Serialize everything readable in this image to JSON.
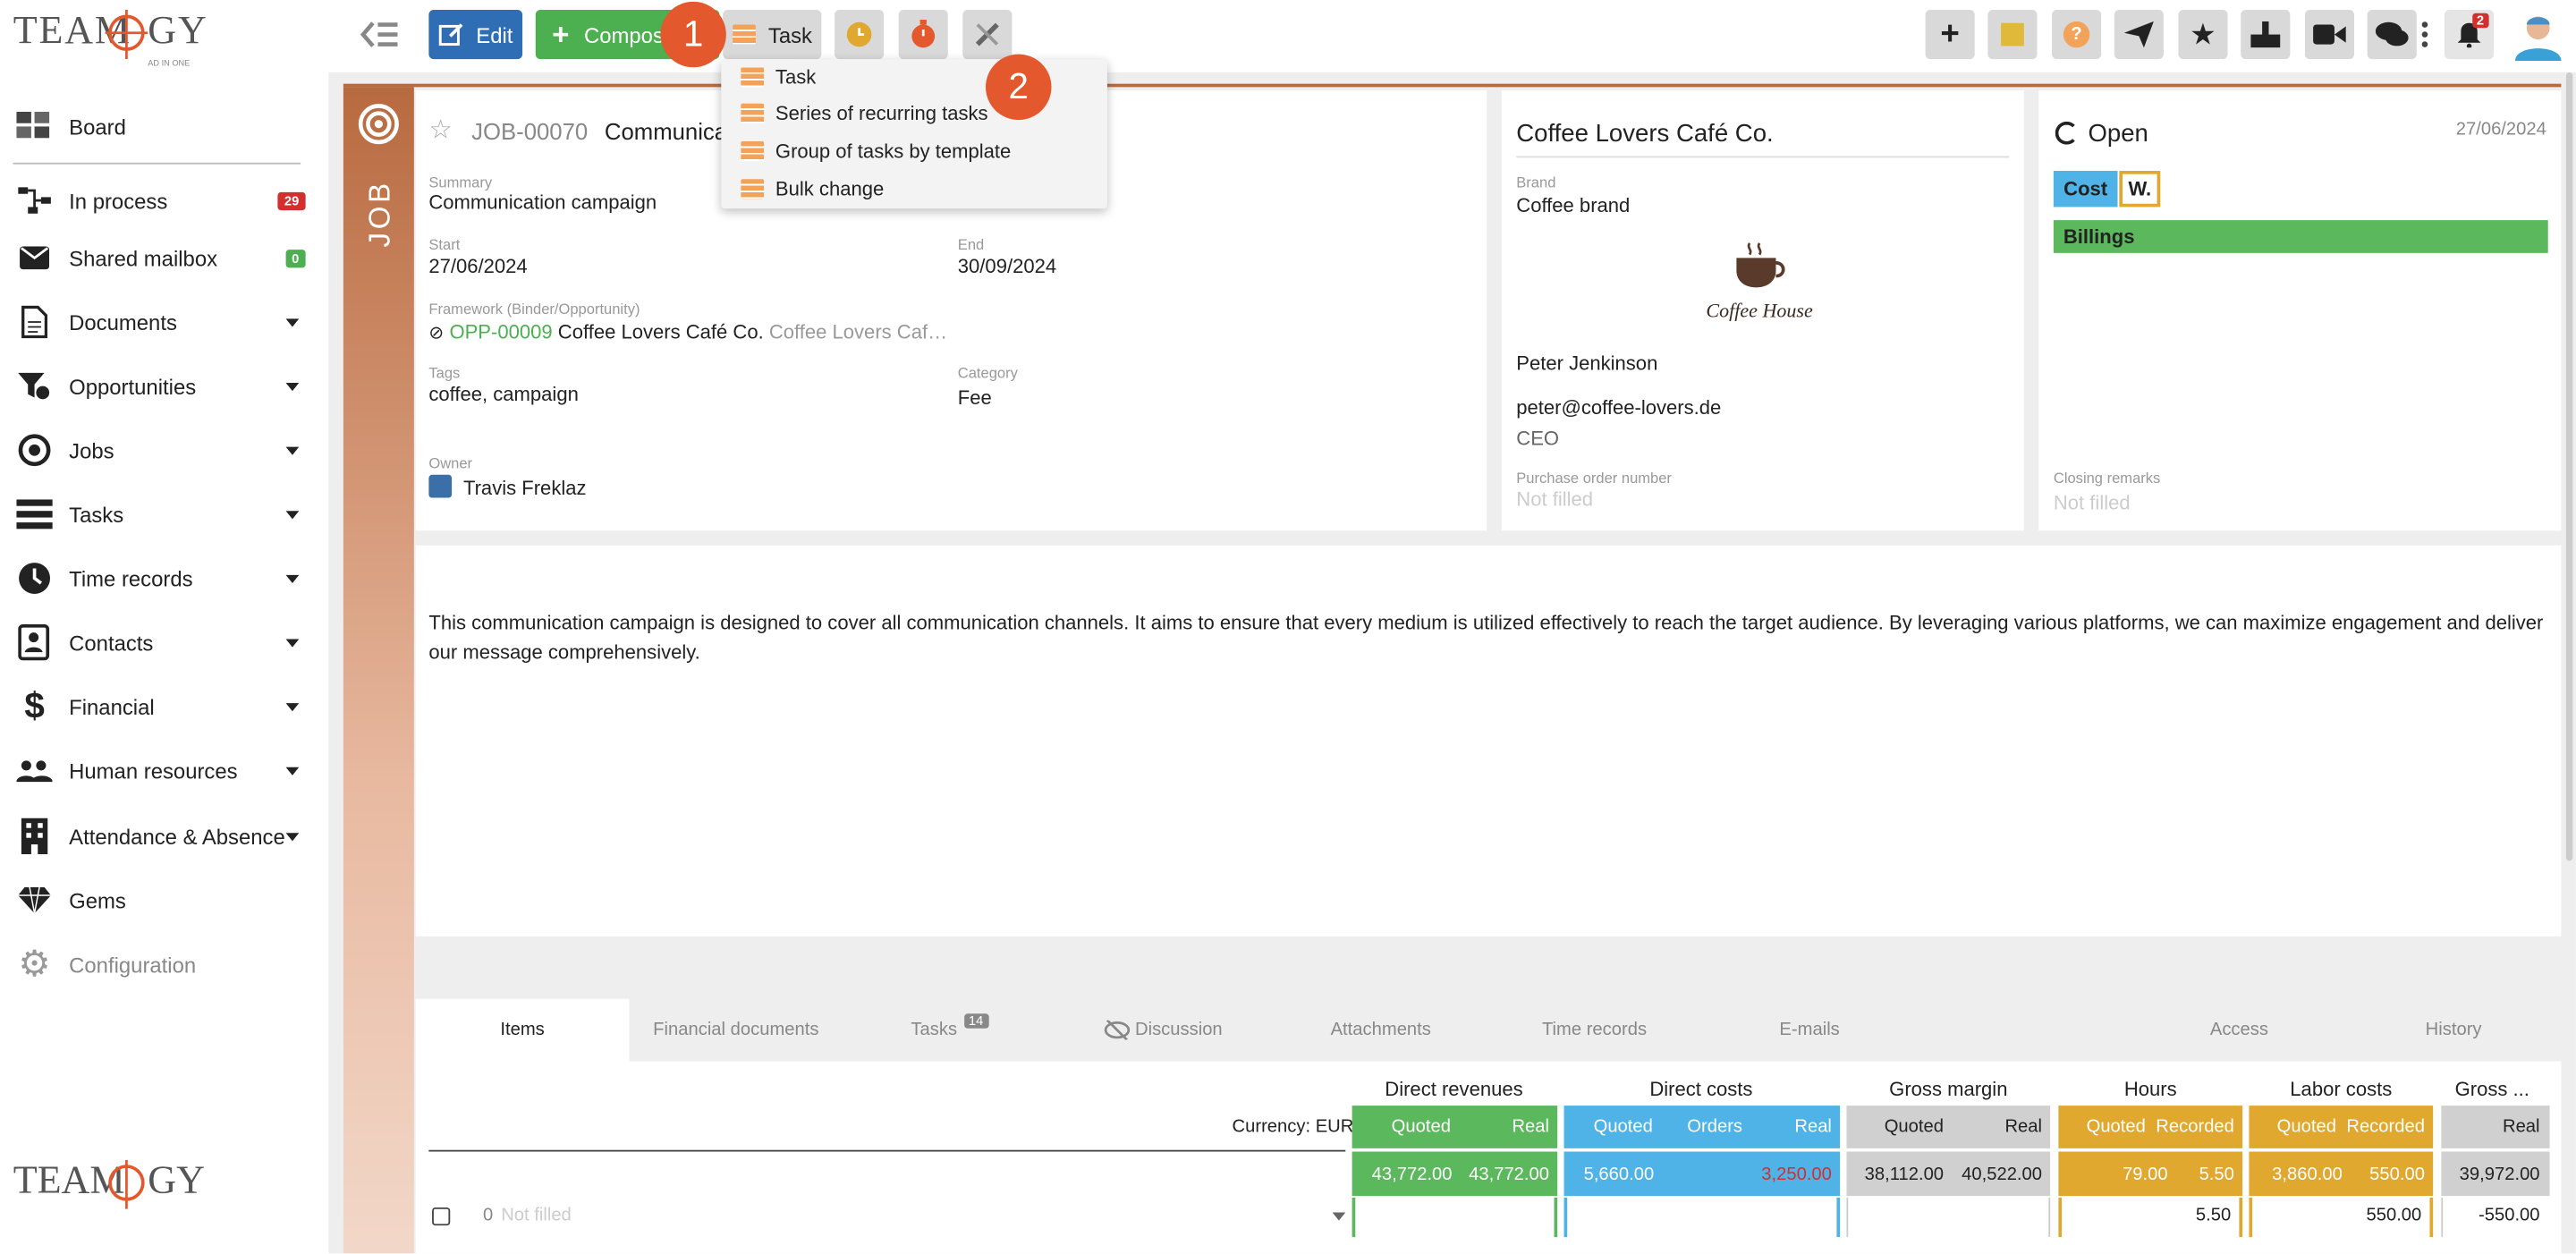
{
  "brand": {
    "logo_text": "TEAM",
    "logo_text2": "GY",
    "logo_sub": "AD IN ONE"
  },
  "sidebar": {
    "items": [
      {
        "label": "Board",
        "icon": "board-icon"
      },
      {
        "label": "In process",
        "icon": "flow-icon",
        "badge": "29"
      },
      {
        "label": "Shared mailbox",
        "icon": "mail-icon",
        "badge": "0"
      },
      {
        "label": "Documents",
        "icon": "document-icon"
      },
      {
        "label": "Opportunities",
        "icon": "funnel-icon"
      },
      {
        "label": "Jobs",
        "icon": "target-icon"
      },
      {
        "label": "Tasks",
        "icon": "tasks-icon"
      },
      {
        "label": "Time records",
        "icon": "clock-icon"
      },
      {
        "label": "Contacts",
        "icon": "contact-icon"
      },
      {
        "label": "Financial",
        "icon": "dollar-icon"
      },
      {
        "label": "Human resources",
        "icon": "people-icon"
      },
      {
        "label": "Attendance & Absence",
        "icon": "building-icon"
      },
      {
        "label": "Gems",
        "icon": "gem-icon"
      },
      {
        "label": "Configuration",
        "icon": "gear-icon"
      }
    ]
  },
  "toolbar": {
    "edit": "Edit",
    "compose": "Compose",
    "task": "Task",
    "notif_count": "2"
  },
  "dropdown": {
    "items": [
      "Task",
      "Series of recurring tasks",
      "Group of tasks by template",
      "Bulk change"
    ]
  },
  "callouts": {
    "one": "1",
    "two": "2"
  },
  "job": {
    "strip_label": "JOB",
    "code": "JOB-00070",
    "title": "Communication campaign",
    "summary_label": "Summary",
    "summary": "Communication campaign",
    "start_label": "Start",
    "start": "27/06/2024",
    "end_label": "End",
    "end": "30/09/2024",
    "framework_label": "Framework (Binder/Opportunity)",
    "framework_code": "OPP-00009",
    "framework_client": "Coffee Lovers Café Co.",
    "framework_extra": "Coffee Lovers Caf…",
    "tags_label": "Tags",
    "tags": "coffee, campaign",
    "category_label": "Category",
    "category": "Fee",
    "owner_label": "Owner",
    "owner": "Travis Freklaz"
  },
  "client": {
    "name": "Coffee Lovers Café Co.",
    "brand_label": "Brand",
    "brand": "Coffee brand",
    "logo_text": "Coffee House",
    "contact": "Peter Jenkinson",
    "email": "peter@coffee-lovers.de",
    "role": "CEO",
    "po_label": "Purchase order number",
    "po": "Not filled"
  },
  "status": {
    "label": "Open",
    "date": "27/06/2024",
    "cost": "Cost",
    "w": "W.",
    "billings": "Billings",
    "closing_label": "Closing remarks",
    "closing": "Not filled"
  },
  "description": "This communication campaign is designed to cover all communication channels. It aims to ensure that every medium is utilized effectively to reach the target audience. By leveraging various platforms, we can maximize engagement and deliver our message comprehensively.",
  "tabs": [
    {
      "label": "Items"
    },
    {
      "label": "Financial documents"
    },
    {
      "label": "Tasks",
      "badge": "14"
    },
    {
      "label": "Discussion"
    },
    {
      "label": "Attachments"
    },
    {
      "label": "Time records"
    },
    {
      "label": "E-mails"
    },
    {
      "label": "Access"
    },
    {
      "label": "History"
    }
  ],
  "table": {
    "currency": "Currency: EUR",
    "groups": {
      "revenues": "Direct revenues",
      "costs": "Direct costs",
      "margin": "Gross margin",
      "hours": "Hours",
      "labor": "Labor costs",
      "gross": "Gross ..."
    },
    "sub": {
      "quoted": "Quoted",
      "real": "Real",
      "orders": "Orders",
      "recorded": "Recorded"
    },
    "totals": {
      "rev_quoted": "43,772.00",
      "rev_real": "43,772.00",
      "cost_quoted": "5,660.00",
      "cost_real": "3,250.00",
      "margin_quoted": "38,112.00",
      "margin_real": "40,522.00",
      "hours_quoted": "79.00",
      "hours_recorded": "5.50",
      "labor_quoted": "3,860.00",
      "labor_recorded": "550.00",
      "gross_real": "39,972.00"
    },
    "row": {
      "num": "0",
      "placeholder": "Not filled",
      "hours": "5.50",
      "labor": "550.00",
      "gross": "-550.00"
    }
  },
  "colors": {
    "orange": "#e3582c",
    "green": "#4caf50",
    "blue": "#4fb3e8",
    "gold": "#e0a82e",
    "gray": "#d0d0d0",
    "edit": "#2f6db5"
  }
}
